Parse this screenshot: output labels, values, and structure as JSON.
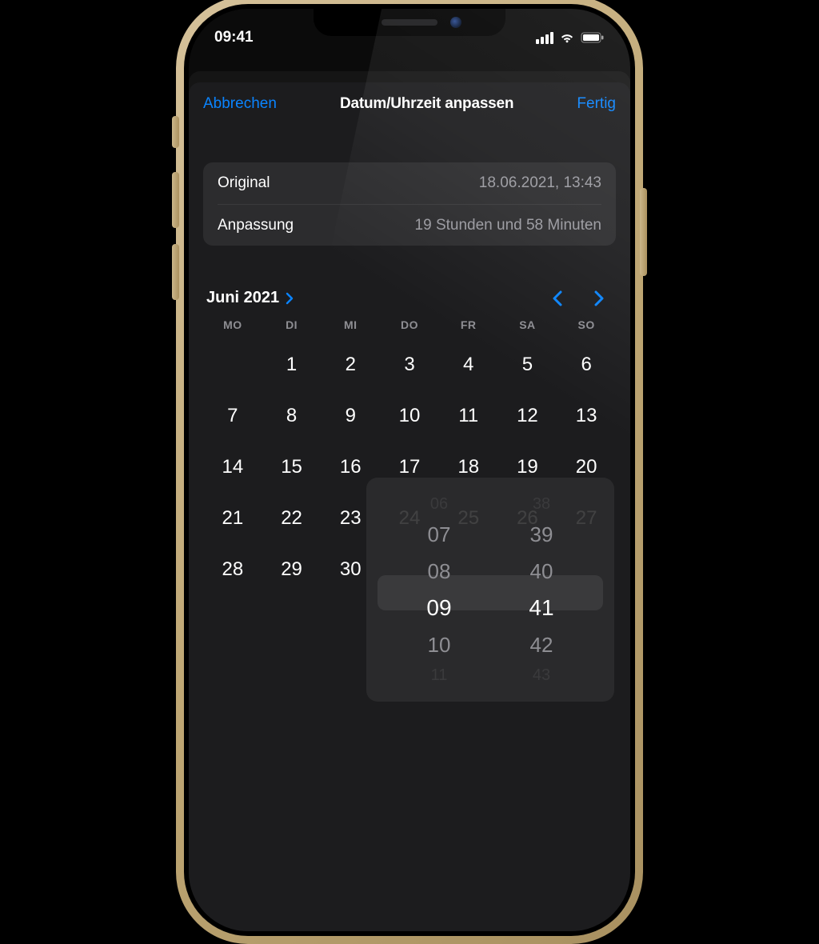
{
  "statusbar": {
    "time": "09:41"
  },
  "nav": {
    "cancel": "Abbrechen",
    "title": "Datum/Uhrzeit anpassen",
    "done": "Fertig"
  },
  "info": {
    "original_label": "Original",
    "original_value": "18.06.2021, 13:43",
    "adjust_label": "Anpassung",
    "adjust_value": "19 Stunden und 58 Minuten"
  },
  "calendar": {
    "month_label": "Juni 2021",
    "weekdays": [
      "MO",
      "DI",
      "MI",
      "DO",
      "FR",
      "SA",
      "SO"
    ],
    "rows": [
      [
        "",
        "1",
        "2",
        "3",
        "4",
        "5",
        "6"
      ],
      [
        "7",
        "8",
        "9",
        "10",
        "11",
        "12",
        "13"
      ],
      [
        "14",
        "15",
        "16",
        "17",
        "18",
        "19",
        "20"
      ],
      [
        "21",
        "22",
        "23",
        "24",
        "25",
        "26",
        "27"
      ],
      [
        "28",
        "29",
        "30",
        "",
        "",
        "",
        ""
      ]
    ]
  },
  "timepicker": {
    "hours": [
      "06",
      "07",
      "08",
      "09",
      "10",
      "11"
    ],
    "minutes": [
      "38",
      "39",
      "40",
      "41",
      "42",
      "43"
    ],
    "selected_hour": "09",
    "selected_minute": "41"
  },
  "colors": {
    "accent": "#0a84ff"
  }
}
